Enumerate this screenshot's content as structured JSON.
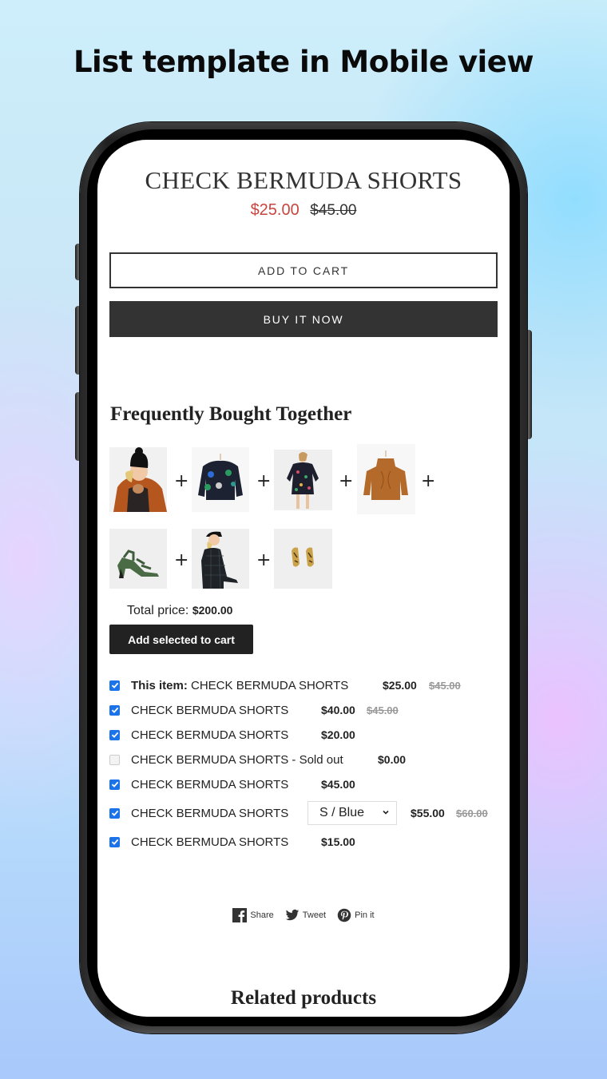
{
  "headline": "List template in Mobile view",
  "product": {
    "title": "CHECK BERMUDA SHORTS",
    "sale_price": "$25.00",
    "original_price": "$45.00",
    "add_to_cart_label": "ADD TO CART",
    "buy_now_label": "BUY IT NOW"
  },
  "fbt": {
    "title": "Frequently Bought Together",
    "plus_sign": "+",
    "thumbnails": [
      {
        "name": "girl-with-beanie-and-fur-jacket"
      },
      {
        "name": "black-sequin-sweatshirt"
      },
      {
        "name": "floral-print-dress"
      },
      {
        "name": "orange-cable-knit-sweater"
      },
      {
        "name": "green-strappy-sandals"
      },
      {
        "name": "check-dress-with-cap"
      },
      {
        "name": "gold-earrings"
      }
    ],
    "total_label": "Total price:",
    "total_value": "$200.00",
    "add_selected_label": "Add selected to cart",
    "items": [
      {
        "prefix": "This item:",
        "name": "CHECK BERMUDA SHORTS",
        "checked": true,
        "price": "$25.00",
        "compare_price": "$45.00"
      },
      {
        "prefix": "",
        "name": "CHECK BERMUDA SHORTS",
        "checked": true,
        "price": "$40.00",
        "compare_price": "$45.00"
      },
      {
        "prefix": "",
        "name": "CHECK BERMUDA SHORTS",
        "checked": true,
        "price": "$20.00",
        "compare_price": ""
      },
      {
        "prefix": "",
        "name": "CHECK BERMUDA SHORTS - Sold out",
        "checked": false,
        "price": "$0.00",
        "compare_price": ""
      },
      {
        "prefix": "",
        "name": "CHECK BERMUDA SHORTS",
        "checked": true,
        "price": "$45.00",
        "compare_price": ""
      },
      {
        "prefix": "",
        "name": "CHECK BERMUDA SHORTS",
        "checked": true,
        "variant": "S / Blue",
        "price": "$55.00",
        "compare_price": "$60.00"
      },
      {
        "prefix": "",
        "name": "CHECK BERMUDA SHORTS",
        "checked": true,
        "price": "$15.00",
        "compare_price": ""
      }
    ]
  },
  "share": {
    "facebook_label": "Share",
    "twitter_label": "Tweet",
    "pinterest_label": "Pin it"
  },
  "related_title": "Related products",
  "colors": {
    "sale_price": "#c8453e",
    "checkbox": "#1a73e8",
    "button_dark": "#333333"
  }
}
